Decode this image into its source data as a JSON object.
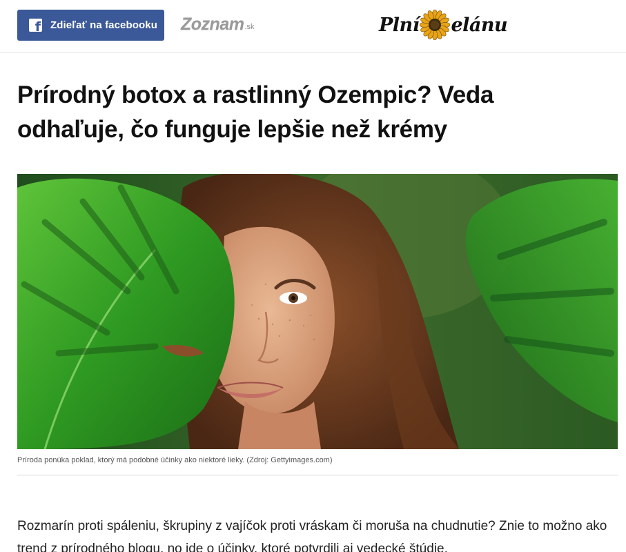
{
  "header": {
    "share_button_label": "Zdieľať na facebooku",
    "partner_logo_main": "Zoznam",
    "partner_logo_suffix": ".sk",
    "site_logo_left": "Plní",
    "site_logo_right": "elánu"
  },
  "article": {
    "headline": "Prírodný botox a rastlinný Ozempic? Veda odhaľuje, čo funguje lepšie než krémy",
    "hero_image_caption": "Príroda ponúka poklad, ktorý má podobné účinky ako niektoré lieky. (Zdroj: Gettyimages.com)",
    "intro_paragraph": "Rozmarín proti spáleniu, škrupiny z vajíčok proti vráskam či moruša na chudnutie? Znie to možno ako trend z prírodného blogu, no ide o účinky, ktoré potvrdili aj vedecké štúdie."
  },
  "icons": {
    "share": "facebook-icon",
    "logo_mark": "sunflower-icon"
  },
  "colors": {
    "facebook_blue": "#3b5998",
    "sunflower_petal": "#e8a317",
    "sunflower_center": "#3a2a10"
  }
}
